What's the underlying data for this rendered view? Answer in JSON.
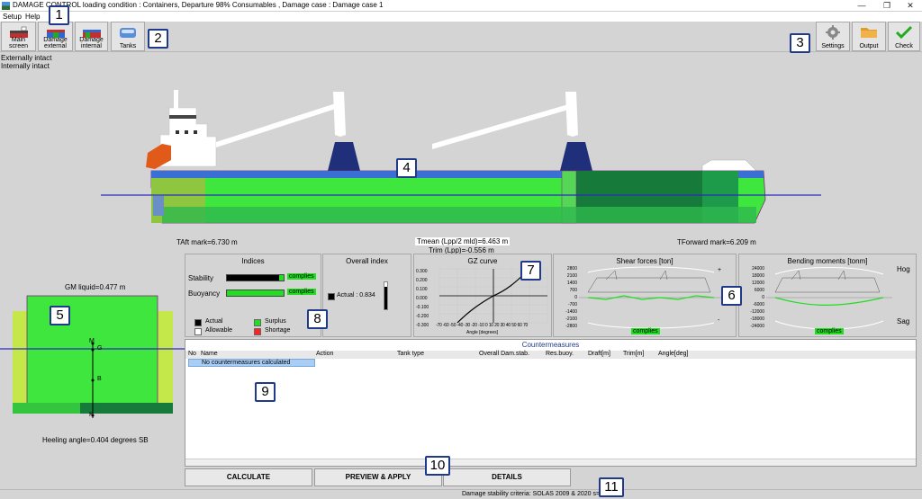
{
  "window": {
    "title": "DAMAGE CONTROL  loading condition : Containers, Departure 98% Consumables , Damage case : Damage case 1",
    "controls": [
      "—",
      "❐",
      "✕"
    ]
  },
  "menu": {
    "items": [
      "Setup",
      "Help"
    ]
  },
  "toolbar": {
    "left": [
      {
        "label": "Main screen",
        "icon": "ship-icon"
      },
      {
        "label": "Damage external",
        "icon": "ship-damage-external-icon"
      },
      {
        "label": "Damage internal",
        "icon": "ship-damage-internal-icon"
      },
      {
        "label": "Tanks",
        "icon": "tanks-icon"
      }
    ],
    "right": [
      {
        "label": "Settings",
        "icon": "gear-icon"
      },
      {
        "label": "Output",
        "icon": "folder-icon"
      },
      {
        "label": "Check",
        "icon": "checkmark-icon"
      }
    ]
  },
  "status_top": {
    "external": "Externally intact",
    "internal": "Internally intact"
  },
  "profile": {
    "taft": "TAft mark=6.730 m",
    "tmean": "Tmean (Lpp/2 mld)=6.463 m",
    "trim": "Trim (Lpp)=-0.556 m",
    "tforward": "TForward mark=6.209 m"
  },
  "section": {
    "gm": "GM liquid=0.477 m",
    "points": [
      "M",
      "G",
      "B",
      "K"
    ],
    "heeling": "Heeling angle=0.404 degrees SB"
  },
  "indices": {
    "title": "Indices",
    "stability_label": "Stability",
    "stability_value": 0.92,
    "stability_status": "complies",
    "buoyancy_label": "Buoyancy",
    "buoyancy_value": 1.0,
    "buoyancy_status": "complies",
    "legend": [
      {
        "label": "Actual",
        "color": "#000000"
      },
      {
        "label": "Surplus",
        "color": "#22dd22"
      },
      {
        "label": "Allowable",
        "color": "#ffffff"
      },
      {
        "label": "Shortage",
        "color": "#ff2222"
      }
    ]
  },
  "overall": {
    "title": "Overall index",
    "label": "Actual : 0.834",
    "value": 0.834
  },
  "gz": {
    "title": "GZ curve",
    "xlabel": "Angle [degrees]",
    "xticks": [
      "-70",
      "-60",
      "-50",
      "-40",
      "-30",
      "-20",
      "-10",
      "0",
      "10",
      "20",
      "30",
      "40",
      "50",
      "60",
      "70"
    ],
    "yticks": [
      "0.300",
      "0.200",
      "0.100",
      "0.000",
      "-0.100",
      "-0.200",
      "-0.300"
    ]
  },
  "shear": {
    "title": "Shear forces [ton]",
    "yticks": [
      "2800",
      "2100",
      "1400",
      "700",
      "0",
      "-700",
      "-1400",
      "-2100",
      "-2800"
    ],
    "plus": "+",
    "minus": "-",
    "status": "complies"
  },
  "bending": {
    "title": "Bending moments [tonm]",
    "yticks": [
      "24000",
      "18000",
      "12000",
      "6000",
      "0",
      "-6000",
      "-12000",
      "-18000",
      "-24000"
    ],
    "hog": "Hog",
    "sag": "Sag",
    "status": "complies"
  },
  "countermeasures": {
    "title": "Countermeasures",
    "columns": [
      "No",
      "Name",
      "Action",
      "Tank type",
      "Overall Dam.stab.",
      "Res.buoy.",
      "Draft[m]",
      "Trim[m]",
      "Angle[deg]"
    ],
    "message": "No countermeasures calculated"
  },
  "buttons": {
    "calculate": "CALCULATE",
    "preview": "PREVIEW & APPLY",
    "details": "DETAILS"
  },
  "statusbar": {
    "text": "Damage stability criteria: SOLAS 2009 & 2020 s=1"
  },
  "markers": [
    "1",
    "2",
    "3",
    "4",
    "5",
    "6",
    "7",
    "8",
    "9",
    "10",
    "11"
  ]
}
